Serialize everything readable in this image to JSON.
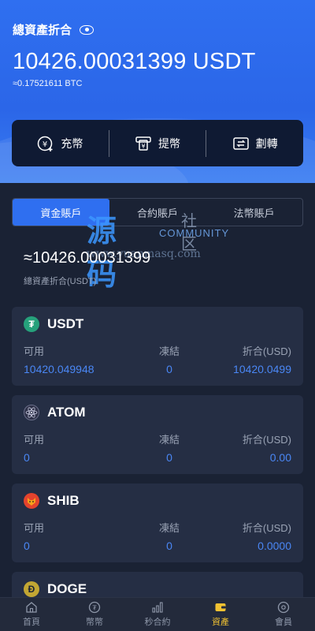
{
  "header": {
    "title": "總資產折合",
    "total_usdt": "10426.00031399 USDT",
    "total_btc": "≈0.17521611 BTC"
  },
  "actions": [
    {
      "label": "充幣",
      "icon": "deposit-icon"
    },
    {
      "label": "提幣",
      "icon": "withdraw-icon"
    },
    {
      "label": "劃轉",
      "icon": "transfer-icon"
    }
  ],
  "tabs": [
    {
      "label": "資金賬戶",
      "active": true
    },
    {
      "label": "合約賬戶",
      "active": false
    },
    {
      "label": "法幣賬戶",
      "active": false
    }
  ],
  "watermark": {
    "cn": "源码",
    "cn2": "社区",
    "en": "COMMUNITY",
    "url": "www.yuanmasq.com"
  },
  "account": {
    "total": "≈10426.00031399",
    "total_label": "總資產折合(USDT)"
  },
  "columns": {
    "available": "可用",
    "frozen": "凍結",
    "converted": "折合(USD)"
  },
  "assets": [
    {
      "symbol": "USDT",
      "available": "10420.049948",
      "frozen": "0",
      "converted": "10420.0499",
      "color": "#26a17b"
    },
    {
      "symbol": "ATOM",
      "available": "0",
      "frozen": "0",
      "converted": "0.00",
      "color": "#2e3148"
    },
    {
      "symbol": "SHIB",
      "available": "0",
      "frozen": "0",
      "converted": "0.0000",
      "color": "#e4432d"
    },
    {
      "symbol": "DOGE",
      "color": "#c2a633"
    }
  ],
  "nav": [
    {
      "label": "首頁",
      "icon": "home-icon",
      "active": false
    },
    {
      "label": "幣幣",
      "icon": "coin-icon",
      "active": false
    },
    {
      "label": "秒合約",
      "icon": "chart-icon",
      "active": false
    },
    {
      "label": "資產",
      "icon": "wallet-icon",
      "active": true
    },
    {
      "label": "會員",
      "icon": "member-icon",
      "active": false
    }
  ]
}
